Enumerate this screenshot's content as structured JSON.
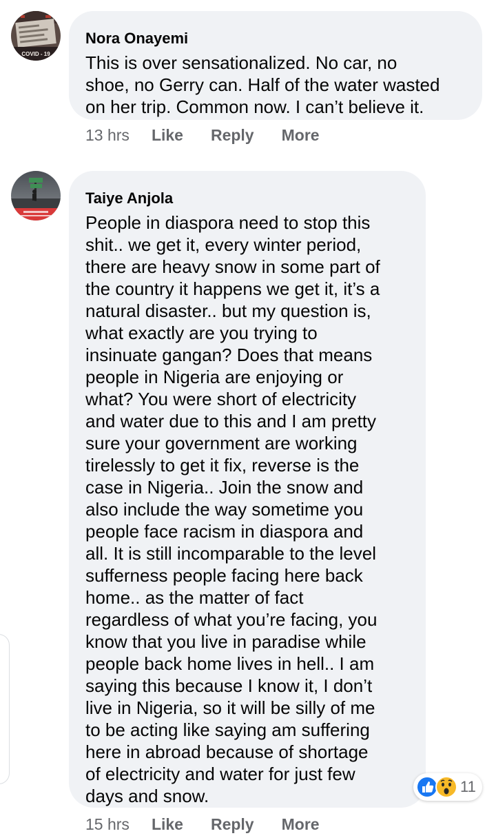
{
  "comments": [
    {
      "author": "Nora Onayemi",
      "text": "This is over sensationalized. No car, no\nshoe, no Gerry can. Half of the water wasted\non her trip. Common now. I can’t believe it.",
      "time": "13 hrs",
      "actions": {
        "like": "Like",
        "reply": "Reply",
        "more": "More"
      },
      "avatar_badge": "COVID - 19"
    },
    {
      "author": "Taiye Anjola",
      "text": "People in diaspora need to stop this\nshit.. we get it, every winter period,\nthere are heavy snow in some part of\nthe country it happens we get it, it’s a\nnatural disaster.. but my question is,\nwhat exactly are you trying to\ninsinuate gangan? Does that means\npeople in Nigeria are enjoying or\nwhat? You were short of electricity\nand water due to this and I am pretty\nsure your government are working\ntirelessly to get it fix, reverse is the\ncase in Nigeria.. Join the snow and\nalso include the way sometime you\npeople face racism in diaspora and\nall. It is still incomparable to the level\nsufferness people facing here back\nhome.. as the matter of fact\nregardless of what you’re facing, you\nknow that you live in paradise while\npeople back home lives in hell.. I am\nsaying this because I know it, I don’t\nlive in Nigeria, so it will be silly of me\nto be acting like saying am suffering\nhere in abroad because of shortage\nof electricity and water for just few\ndays and snow.",
      "time": "15 hrs",
      "actions": {
        "like": "Like",
        "reply": "Reply",
        "more": "More"
      },
      "reactions": {
        "icons": [
          "like-icon",
          "wow-icon"
        ],
        "count": "11"
      }
    }
  ],
  "colors": {
    "bubble": "#f0f2f5",
    "meta_text": "#65676b",
    "like_blue": "#1877f2",
    "wow_yellow": "#f7b928"
  }
}
